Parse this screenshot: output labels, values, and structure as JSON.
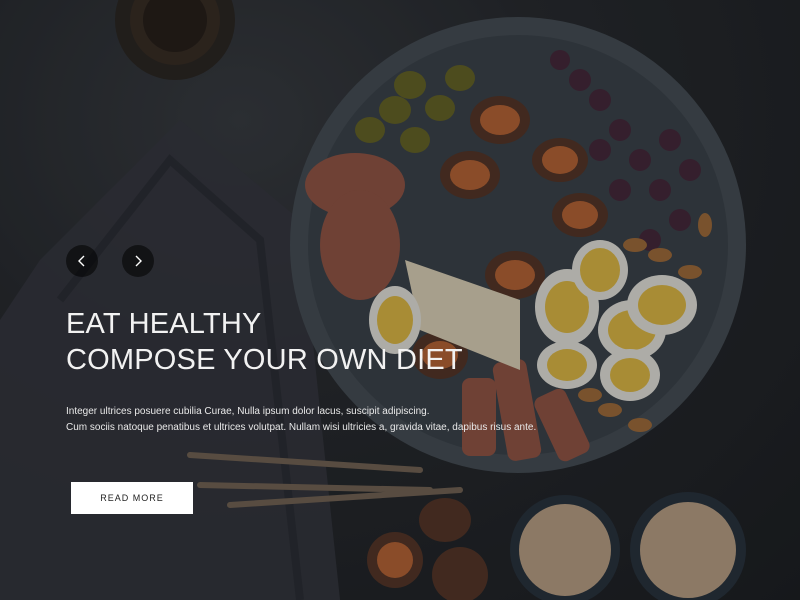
{
  "hero": {
    "headline": {
      "line1": "EAT HEALTHY",
      "line2": "COMPOSE YOUR OWN DIET"
    },
    "description": {
      "line1": "Integer ultrices posuere cubilia Curae, Nulla ipsum dolor lacus, suscipit adipiscing.",
      "line2": "Cum sociis natoque penatibus et ultrices volutpat. Nullam wisi ultricies a, gravida vitae, dapibus risus ante."
    },
    "cta_label": "READ MORE"
  },
  "controls": {
    "prev_icon": "chevron-left-icon",
    "next_icon": "chevron-right-icon"
  },
  "colors": {
    "background": "#2b2e33",
    "overlay": "rgba(0,0,0,0.28)",
    "text": "#f2f2f2",
    "button_bg": "#ffffff",
    "button_text": "#222222"
  }
}
